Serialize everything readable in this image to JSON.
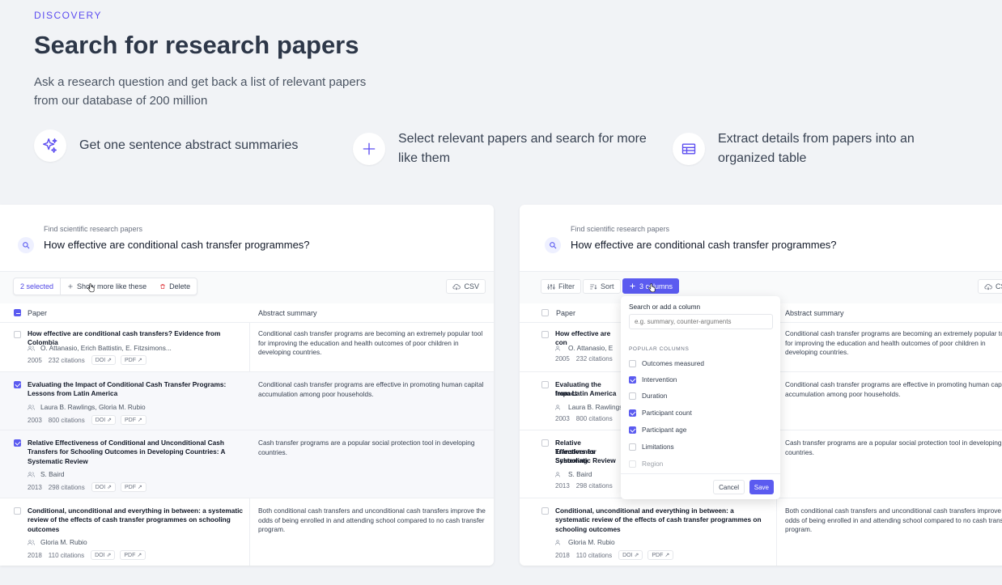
{
  "hero": {
    "eyebrow": "DISCOVERY",
    "title": "Search for research papers",
    "subtitle": "Ask a research question and get back a list of relevant papers from our database of 200 million"
  },
  "features": [
    {
      "icon": "sparkles-icon",
      "text": "Get one sentence abstract summaries"
    },
    {
      "icon": "plus-icon",
      "text": "Select relevant papers and search for more like them"
    },
    {
      "icon": "table-icon",
      "text": "Extract details from papers into an organized table"
    }
  ],
  "search": {
    "label": "Find scientific research papers",
    "query": "How effective are conditional cash transfer programmes?"
  },
  "left_toolbar": {
    "selected": "2 selected",
    "show_more": "Show more like these",
    "delete": "Delete",
    "csv": "CSV"
  },
  "right_toolbar": {
    "filter": "Filter",
    "sort": "Sort",
    "columns": "3 columns",
    "csv": "CSV"
  },
  "table": {
    "col_paper": "Paper",
    "col_abstract": "Abstract summary",
    "doi_label": "DOI",
    "pdf_label": "PDF",
    "rows": [
      {
        "title": "How effective are conditional cash transfers? Evidence from Colombia",
        "title_short": "How effective are con",
        "authors": "O. Attanasio, Erich Battistin, E. Fitzsimons...",
        "authors_short": "O. Attanasio, E",
        "year": "2005",
        "citations": "232 citations",
        "abstract": "Conditional cash transfer programs are becoming an extremely popular tool for improving the education and health outcomes of poor children in developing countries.",
        "abstract_r": "Conditional cash transfer programs are becoming an extremely popular to for improving the education and health outcomes of poor children in developing countries.",
        "checked": false
      },
      {
        "title": "Evaluating the Impact of Conditional Cash Transfer Programs: Lessons from Latin America",
        "title_short": "Evaluating the Impact",
        "title_short2": "from Latin America",
        "authors": "Laura B. Rawlings, Gloria M. Rubio",
        "authors_short": "Laura B. Rawlings",
        "year": "2003",
        "citations": "800 citations",
        "abstract": "Conditional cash transfer programs are effective in promoting human capital accumulation among poor households.",
        "abstract_r": "Conditional cash transfer programs are effective in promoting human capi accumulation among poor households.",
        "checked": true
      },
      {
        "title": "Relative Effectiveness of Conditional and Unconditional Cash Transfers for Schooling Outcomes in Developing Countries: A Systematic Review",
        "title_short": "Relative Effectivenes",
        "title_short2": "Transfers for Schooling",
        "title_short3": "Systematic Review",
        "authors": "S. Baird",
        "year": "2013",
        "citations": "298 citations",
        "abstract": "Cash transfer programs are a popular social protection tool in developing countries.",
        "abstract_r": "Cash transfer programs are a popular social protection tool in developing countries.",
        "checked": true
      },
      {
        "title": "Conditional, unconditional and everything in between: a systematic review of the effects of cash transfer programmes on schooling outcomes",
        "authors": "Gloria M. Rubio",
        "year": "2018",
        "citations": "110 citations",
        "abstract": "Both conditional cash transfers and unconditional cash transfers improve the odds of being enrolled in and attending school compared to no cash transfer program.",
        "abstract_r": "Both conditional cash transfers and unconditional cash transfers improve odds of being enrolled in and attending school compared to no cash trans program.",
        "checked": false
      }
    ]
  },
  "dropdown": {
    "label": "Search or add a column",
    "placeholder": "e.g. summary, counter-arguments",
    "section": "POPULAR COLUMNS",
    "options": [
      {
        "label": "Outcomes measured",
        "checked": false
      },
      {
        "label": "Intervention",
        "checked": true
      },
      {
        "label": "Duration",
        "checked": false
      },
      {
        "label": "Participant count",
        "checked": true
      },
      {
        "label": "Participant age",
        "checked": true
      },
      {
        "label": "Limitations",
        "checked": false
      },
      {
        "label": "Region",
        "checked": false
      }
    ],
    "cancel": "Cancel",
    "save": "Save"
  },
  "colors": {
    "accent": "#5b5bf0",
    "eyebrow": "#5b4cf0"
  }
}
